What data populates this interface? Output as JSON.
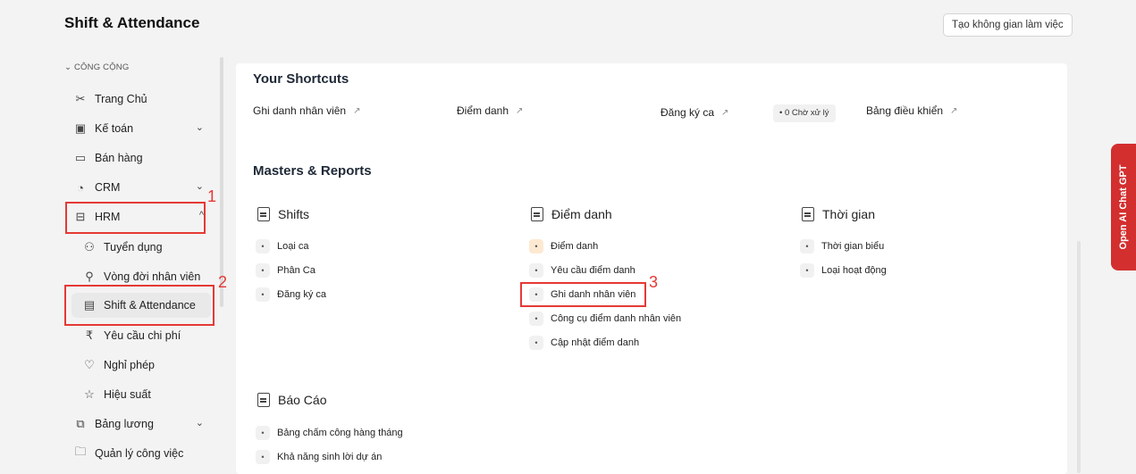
{
  "header": {
    "title": "Shift & Attendance",
    "workspace_button": "Tạo không gian làm việc"
  },
  "sidebar": {
    "section": "⌄ CÔNG CỘNG",
    "items": [
      {
        "label": "Trang Chủ",
        "icon": "tools-icon"
      },
      {
        "label": "Kế toán",
        "icon": "accounting-icon",
        "chevron": "⌄"
      },
      {
        "label": "Bán hàng",
        "icon": "sales-icon"
      },
      {
        "label": "CRM",
        "icon": "crm-icon",
        "chevron": "⌄"
      },
      {
        "label": "HRM",
        "icon": "hrm-icon",
        "chevron": "^"
      },
      {
        "label": "Tuyển dụng",
        "icon": "recruit-icon"
      },
      {
        "label": "Vòng đời nhân viên",
        "icon": "lifecycle-icon"
      },
      {
        "label": "Shift & Attendance",
        "icon": "shift-icon"
      },
      {
        "label": "Yêu cầu chi phí",
        "icon": "expense-icon"
      },
      {
        "label": "Nghỉ phép",
        "icon": "leave-icon"
      },
      {
        "label": "Hiệu suất",
        "icon": "star-icon"
      },
      {
        "label": "Bảng lương",
        "icon": "payroll-icon",
        "chevron": "⌄"
      },
      {
        "label": "Quản lý công việc",
        "icon": "folder-icon"
      }
    ]
  },
  "annotations": {
    "one": "1",
    "two": "2",
    "three": "3",
    "color": "#e53935"
  },
  "shortcuts": {
    "title": "Your Shortcuts",
    "items": [
      "Ghi danh nhân viên",
      "Điểm danh",
      "Đăng ký ca",
      "Bảng điều khiển"
    ],
    "arrow": "↗",
    "pending": "• 0 Chờ xử lý"
  },
  "masters": {
    "title": "Masters & Reports",
    "cards": [
      {
        "title": "Shifts",
        "links": [
          "Loại ca",
          "Phân Ca",
          "Đăng ký ca"
        ]
      },
      {
        "title": "Điểm danh",
        "links": [
          "Điểm danh",
          "Yêu cầu điểm danh",
          "Ghi danh nhân viên",
          "Công cụ điểm danh nhân viên",
          "Cập nhật điểm danh"
        ]
      },
      {
        "title": "Thời gian",
        "links": [
          "Thời gian biểu",
          "Loại hoạt động"
        ]
      },
      {
        "title": "Báo Cáo",
        "links": [
          "Bảng chấm công hàng tháng",
          "Khả năng sinh lời dự án"
        ]
      }
    ]
  },
  "chat": {
    "label": "Open AI Chat GPT",
    "color": "#d32f2f"
  }
}
